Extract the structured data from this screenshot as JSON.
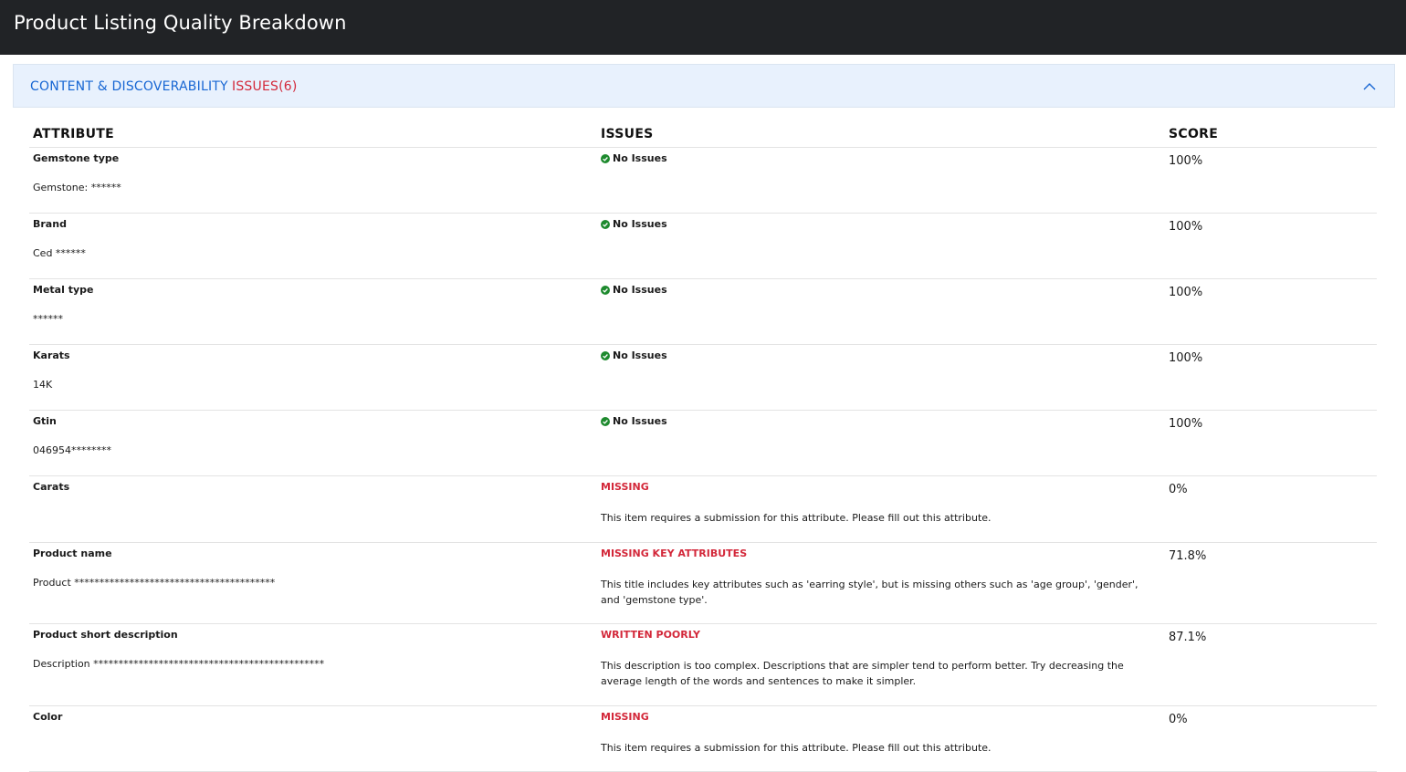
{
  "header": {
    "title": "Product Listing Quality Breakdown"
  },
  "section": {
    "title": "CONTENT & DISCOVERABILITY",
    "issues_label": "ISSUES(6)"
  },
  "table": {
    "columns": [
      "ATTRIBUTE",
      "ISSUES",
      "SCORE"
    ],
    "rows": [
      {
        "attribute": "Gemstone type",
        "value": "Gemstone: ******",
        "status": "ok",
        "issue": "No Issues",
        "description": "",
        "score": "100%"
      },
      {
        "attribute": "Brand",
        "value": "Ced ******",
        "status": "ok",
        "issue": "No Issues",
        "description": "",
        "score": "100%"
      },
      {
        "attribute": "Metal type",
        "value": "******",
        "status": "ok",
        "issue": "No Issues",
        "description": "",
        "score": "100%"
      },
      {
        "attribute": "Karats",
        "value": "14K",
        "status": "ok",
        "issue": "No Issues",
        "description": "",
        "score": "100%"
      },
      {
        "attribute": "Gtin",
        "value": "046954********",
        "status": "ok",
        "issue": "No Issues",
        "description": "",
        "score": "100%"
      },
      {
        "attribute": "Carats",
        "value": "",
        "status": "issue",
        "issue": "MISSING",
        "description": "This item requires a submission for this attribute. Please fill out this attribute.",
        "score": "0%"
      },
      {
        "attribute": "Product name",
        "value": "Product ****************************************",
        "status": "issue",
        "issue": "MISSING KEY ATTRIBUTES",
        "description": "This title includes key attributes such as 'earring style', but is missing others such as 'age group', 'gender', and 'gemstone type'.",
        "score": "71.8%"
      },
      {
        "attribute": "Product short description",
        "value": "Description **********************************************",
        "status": "issue",
        "issue": "WRITTEN POORLY",
        "description": "This description is too complex. Descriptions that are simpler tend to perform better. Try decreasing the average length of the words and sentences to make it simpler.",
        "score": "87.1%"
      },
      {
        "attribute": "Color",
        "value": "",
        "status": "issue",
        "issue": "MISSING",
        "description": "This item requires a submission for this attribute. Please fill out this attribute.",
        "score": "0%"
      }
    ]
  },
  "colors": {
    "topbar": "#212326",
    "accent_blue": "#1766d3",
    "issue_red": "#d3283a",
    "ok_green": "#1e8a2e",
    "section_bg": "#e8f1fd"
  },
  "icons": {
    "ok": "check-circle-icon",
    "collapse": "chevron-up-icon"
  }
}
